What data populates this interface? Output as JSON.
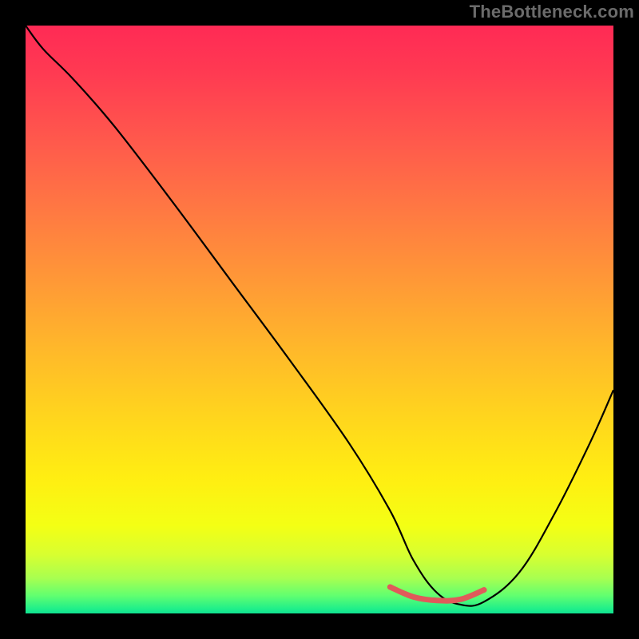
{
  "watermark": "TheBottleneck.com",
  "chart_data": {
    "type": "line",
    "title": "",
    "xlabel": "",
    "ylabel": "",
    "xlim": [
      0,
      100
    ],
    "ylim": [
      0,
      100
    ],
    "grid": false,
    "legend": false,
    "series": [
      {
        "name": "bottleneck-curve",
        "x": [
          0,
          3,
          8,
          15,
          25,
          35,
          45,
          55,
          62,
          66,
          70,
          74,
          78,
          84,
          90,
          96,
          100
        ],
        "y": [
          100,
          96,
          91,
          83,
          70,
          56.5,
          43,
          29,
          17.5,
          9,
          3.5,
          1.5,
          2,
          7,
          17,
          29,
          38
        ]
      }
    ],
    "accent_segment": {
      "name": "optimal-range",
      "x": [
        62,
        66,
        70,
        74,
        78
      ],
      "y": [
        4.5,
        2.8,
        2.2,
        2.4,
        4.0
      ],
      "color": "#e05a5a"
    },
    "background_gradient": {
      "top": "#ff2a55",
      "mid": "#ffee12",
      "bottom": "#10e090"
    }
  }
}
